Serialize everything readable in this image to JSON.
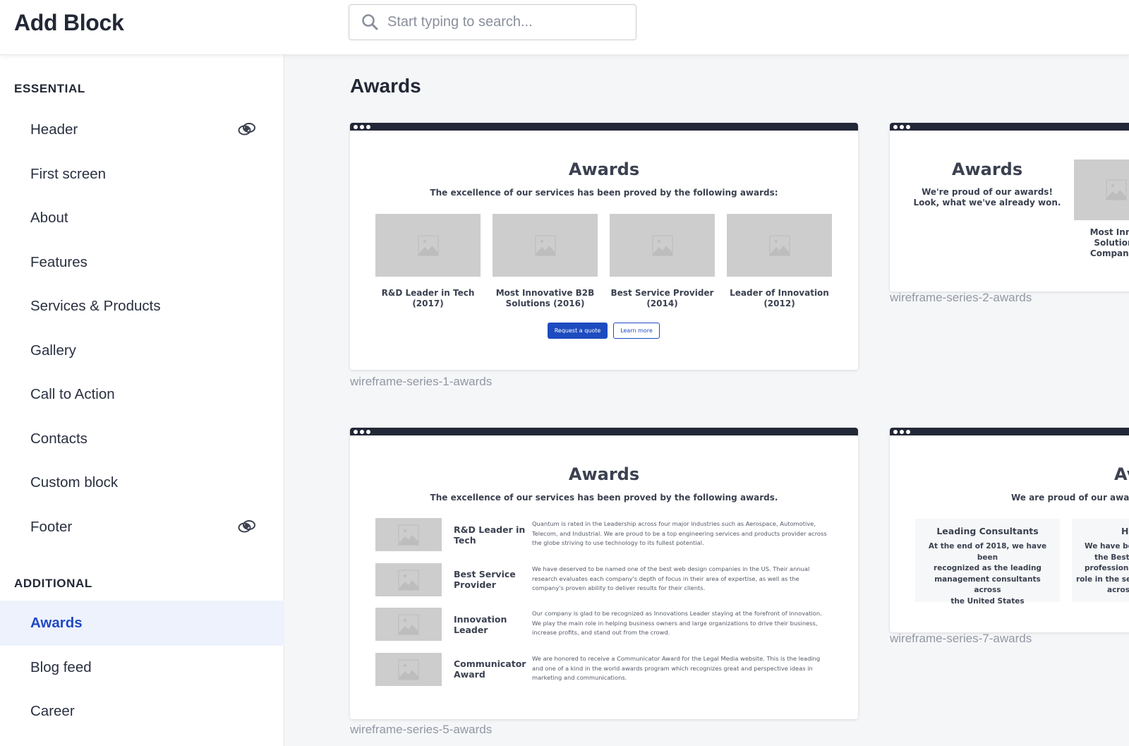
{
  "header": {
    "title": "Add Block",
    "search_placeholder": "Start typing to search...",
    "search_value": ""
  },
  "sidebar": {
    "sections": [
      {
        "label": "ESSENTIAL",
        "items": [
          {
            "label": "Header",
            "icon": "visibility-toggle-icon"
          },
          {
            "label": "First screen"
          },
          {
            "label": "About"
          },
          {
            "label": "Features"
          },
          {
            "label": "Services & Products"
          },
          {
            "label": "Gallery"
          },
          {
            "label": "Call to Action"
          },
          {
            "label": "Contacts"
          },
          {
            "label": "Custom block"
          },
          {
            "label": "Footer",
            "icon": "visibility-toggle-icon"
          }
        ]
      },
      {
        "label": "ADDITIONAL",
        "items": [
          {
            "label": "Awards",
            "active": true
          },
          {
            "label": "Blog feed"
          },
          {
            "label": "Career"
          }
        ]
      }
    ]
  },
  "main": {
    "title": "Awards",
    "templates": [
      {
        "caption": "wireframe-series-1-awards",
        "preview": {
          "title": "Awards",
          "subtitle": "The excellence of our services has been proved by the following awards:",
          "awards": [
            {
              "line1": "R&D Leader in Tech",
              "line2": "(2017)"
            },
            {
              "line1": "Most Innovative B2B",
              "line2": "Solutions (2016)"
            },
            {
              "line1": "Best Service Provider",
              "line2": "(2014)"
            },
            {
              "line1": "Leader of Innovation",
              "line2": "(2012)"
            }
          ],
          "primary_button": "Request a quote",
          "secondary_button": "Learn more"
        }
      },
      {
        "caption": "wireframe-series-2-awards",
        "preview": {
          "title": "Awards",
          "subtitle_line1": "We're proud of our awards!",
          "subtitle_line2": "Look, what we've already won.",
          "award_caption": [
            "Most Innov",
            "Solutions",
            "Companies"
          ]
        }
      },
      {
        "caption": "wireframe-series-5-awards",
        "preview": {
          "title": "Awards",
          "subtitle": "The excellence of our services has been proved by the following awards.",
          "rows": [
            {
              "title_line1": "R&D Leader in",
              "title_line2": "Tech",
              "text": "Quantum is rated in the Leadership across four major industries such as Aerospace, Automotive, Telecom, and Industrial. We are proud to be a top engineering services and products provider across the globe striving to use technology to its fullest potential."
            },
            {
              "title_line1": "Best Service",
              "title_line2": "Provider",
              "text": "We have deserved to be named one of the best web design companies in the US. Their annual research evaluates each company's depth of focus in their area of expertise, as well as the company's proven ability to deliver results for their clients."
            },
            {
              "title_line1": "Innovation",
              "title_line2": "Leader",
              "text": "Our company is glad to be recognized as Innovations Leader staying at the forefront of innovation. We play the main role in helping business owners and large organizations to drive their business, increase profits, and stand out from the crowd."
            },
            {
              "title_line1": "Communicator",
              "title_line2": "Award",
              "text": "We are honored to receive a Communicator Award for the Legal Media website. This is the leading and one of a kind in the world awards program which recognizes great and perspective ideas in marketing and communications."
            }
          ]
        }
      },
      {
        "caption": "wireframe-series-7-awards",
        "preview": {
          "title": "Av",
          "subtitle": "We are proud of our award",
          "boxes": [
            {
              "title": "Leading Consultants",
              "lines": [
                "At the end of 2018, we have been",
                "recognized as the leading",
                "management consultants across",
                "the United States"
              ]
            },
            {
              "title": "Hi",
              "lines": [
                "We have bee",
                "the Best I",
                "professional",
                "role in the se",
                "acros"
              ]
            }
          ]
        }
      }
    ]
  },
  "colors": {
    "accent": "#2249c2",
    "active_bg": "#edf2fd",
    "chrome": "#232838",
    "button_primary": "#1d4cc0",
    "placeholder_gray": "#cdcdcd"
  }
}
